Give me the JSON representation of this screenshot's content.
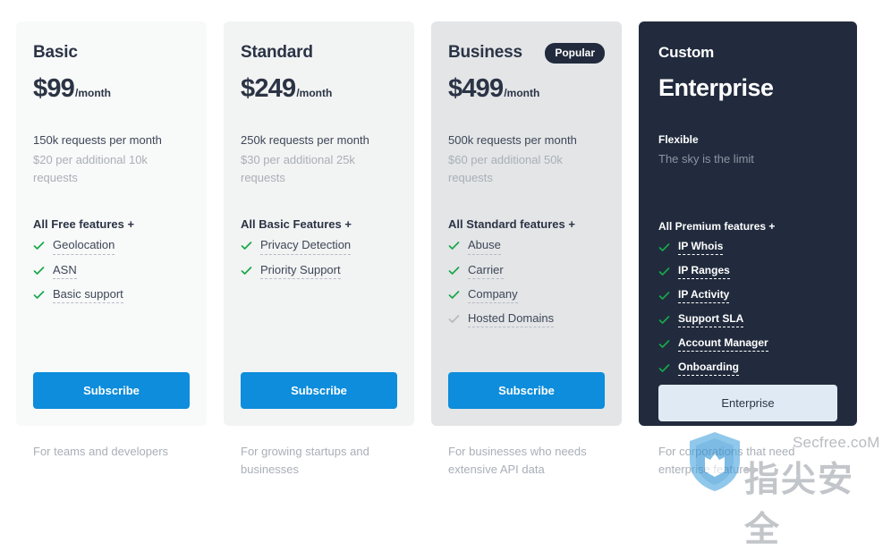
{
  "plans": [
    {
      "id": "basic",
      "name": "Basic",
      "badge": null,
      "price": "$99",
      "period": "/month",
      "quota_main": "150k requests per month",
      "quota_sub": "$20 per additional 10k requests",
      "features_heading": "All Free features +",
      "features": [
        {
          "label": "Geolocation",
          "state": "active"
        },
        {
          "label": "ASN",
          "state": "active"
        },
        {
          "label": "Basic support",
          "state": "active"
        }
      ],
      "cta_label": "Subscribe",
      "cta_style": "subscribe",
      "footnote": "For teams and developers"
    },
    {
      "id": "standard",
      "name": "Standard",
      "badge": null,
      "price": "$249",
      "period": "/month",
      "quota_main": "250k requests per month",
      "quota_sub": "$30 per additional 25k requests",
      "features_heading": "All Basic Features +",
      "features": [
        {
          "label": "Privacy Detection",
          "state": "active"
        },
        {
          "label": "Priority Support",
          "state": "active"
        }
      ],
      "cta_label": "Subscribe",
      "cta_style": "subscribe",
      "footnote": "For growing startups and businesses"
    },
    {
      "id": "business",
      "name": "Business",
      "badge": "Popular",
      "price": "$499",
      "period": "/month",
      "quota_main": "500k requests per month",
      "quota_sub": "$60 per additional 50k requests",
      "features_heading": "All Standard features +",
      "features": [
        {
          "label": "Abuse",
          "state": "active"
        },
        {
          "label": "Carrier",
          "state": "active"
        },
        {
          "label": "Company",
          "state": "active"
        },
        {
          "label": "Hosted Domains",
          "state": "muted"
        }
      ],
      "cta_label": "Subscribe",
      "cta_style": "subscribe",
      "footnote": "For businesses who needs extensive API data"
    },
    {
      "id": "custom",
      "name": "Custom",
      "badge": null,
      "price": "Enterprise",
      "period": "",
      "quota_main": "Flexible",
      "quota_sub": "The sky is the limit",
      "features_heading": "All Premium features +",
      "features": [
        {
          "label": "IP Whois",
          "state": "active"
        },
        {
          "label": "IP Ranges",
          "state": "active"
        },
        {
          "label": "IP Activity",
          "state": "active"
        },
        {
          "label": "Support SLA",
          "state": "active"
        },
        {
          "label": "Account Manager",
          "state": "active"
        },
        {
          "label": "Onboarding",
          "state": "active"
        }
      ],
      "cta_label": "Enterprise",
      "cta_style": "enterprise",
      "footnote": "For corporations that need enterprise features"
    }
  ],
  "colors": {
    "accent_blue": "#0d8ddb",
    "dark_navy": "#212b3d",
    "check_green": "#18a64a",
    "check_muted": "#b4b9c0",
    "enterprise_button": "#dfeaf4"
  },
  "watermark": {
    "domain": "Secfree.coM",
    "brand_cn": "指尖安全",
    "icon": "shield-icon"
  }
}
